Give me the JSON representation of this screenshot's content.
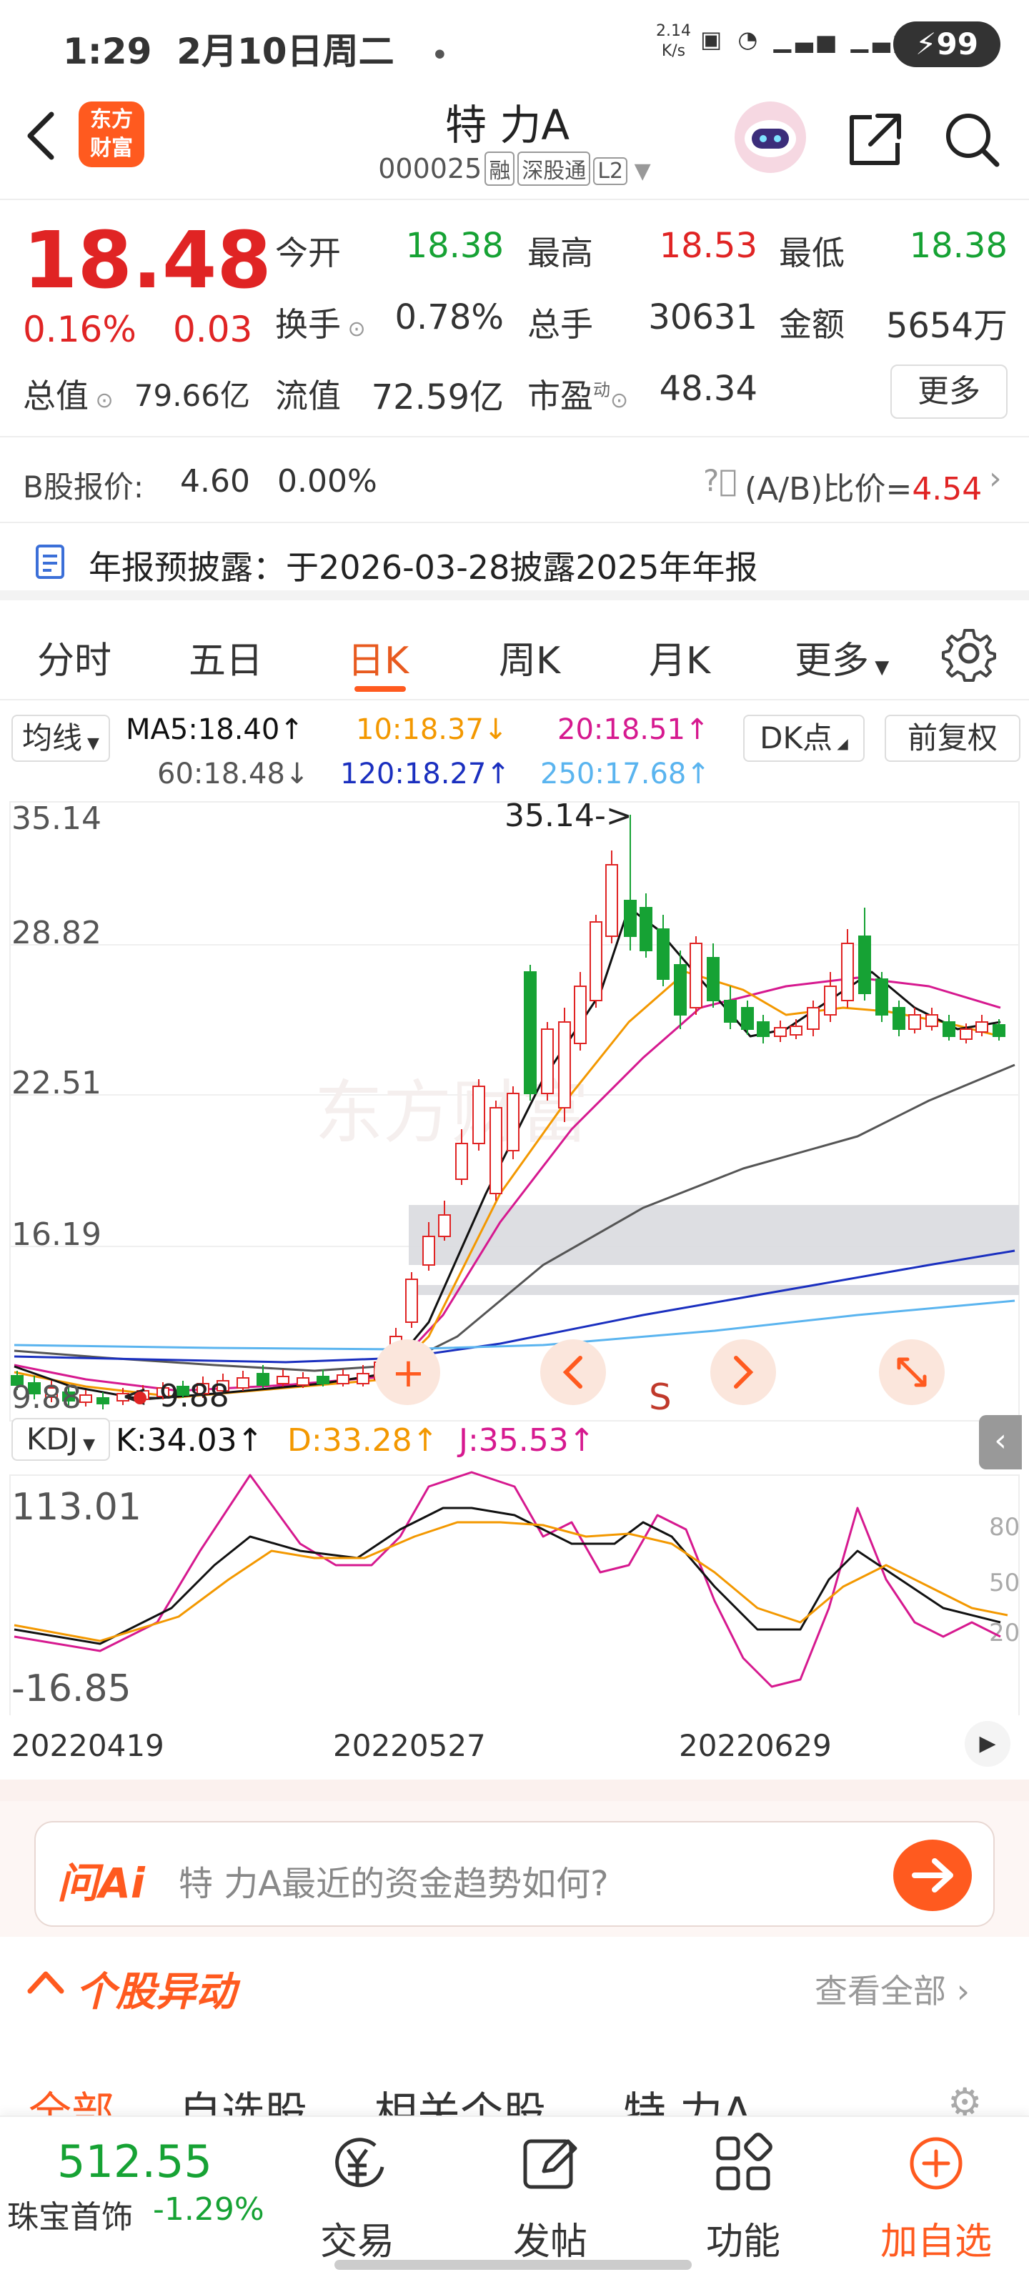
{
  "status": {
    "time": "1:29",
    "date": "2月10日周二",
    "dot": "•",
    "net_speed_top": "2.14",
    "net_speed_bottom": "K/s",
    "battery": "99"
  },
  "header": {
    "logo_line1": "东方",
    "logo_line2": "财富",
    "title": "特  力A",
    "code": "000025",
    "tags": [
      "融",
      "深股通",
      "L2"
    ]
  },
  "quote": {
    "price": "18.48",
    "change_pct": "0.16%",
    "change": "0.03",
    "labels": [
      "今开",
      "最高",
      "最低",
      "换手",
      "总手",
      "金额",
      "总值",
      "流值",
      "市盈"
    ],
    "open": "18.38",
    "high": "18.53",
    "low": "18.38",
    "turnover": "0.78%",
    "volume": "30631",
    "amount": "5654万",
    "total_value": "79.66亿",
    "float_value": "72.59亿",
    "pe_tag": "动",
    "pe": "48.34",
    "more": "更多"
  },
  "bshare": {
    "label": "B股报价:",
    "price": "4.60",
    "pct": "0.00%",
    "ratio_label": "(A/B)比价=",
    "ratio_value": "4.54"
  },
  "notice": {
    "text": "年报预披露：于2026-03-28披露2025年年报"
  },
  "tabs": [
    {
      "label": "分时"
    },
    {
      "label": "五日"
    },
    {
      "label": "日K"
    },
    {
      "label": "周K"
    },
    {
      "label": "月K"
    },
    {
      "label": "更多"
    }
  ],
  "ma": {
    "selector": "均线",
    "ma5": "MA5:18.40",
    "ma10": "10:18.37",
    "ma20": "20:18.51",
    "ma60": "60:18.48",
    "ma120": "120:18.27",
    "ma250": "250:17.68",
    "dk": "DK点",
    "adjust": "前复权",
    "arrow_up": "↑",
    "arrow_down": "↓"
  },
  "chart": {
    "y_labels": [
      "35.14",
      "28.82",
      "22.51",
      "16.19",
      "9.88"
    ],
    "high_marker": "35.14->",
    "low_marker": "<-9.88",
    "watermark": "东方财富",
    "signal": "S",
    "colors": {
      "up": "#e02424",
      "down": "#16a234",
      "ma5": "#111111",
      "ma10": "#f39800",
      "ma20": "#d6198f",
      "ma60": "#555555",
      "ma120": "#1a2fbf",
      "ma250": "#5ab4ef"
    }
  },
  "kdj": {
    "selector": "KDJ",
    "k": "K:34.03",
    "d": "D:33.28",
    "j": "J:35.53",
    "y_top": "113.01",
    "y_bottom": "-16.85",
    "levels": [
      "80",
      "50",
      "20"
    ]
  },
  "dates": [
    "20220419",
    "20220527",
    "20220629"
  ],
  "ask": {
    "logo": "问Ai",
    "question": "特  力A最近的资金趋势如何?"
  },
  "movement": {
    "title": "个股异动",
    "view_all": "查看全部"
  },
  "subtabs": [
    "全部",
    "自选股",
    "相关个股",
    "特  力A"
  ],
  "bottom": {
    "index_value": "512.55",
    "index_name": "珠宝首饰",
    "index_pct": "-1.29%",
    "items": [
      "交易",
      "发帖",
      "功能",
      "加自选"
    ]
  }
}
